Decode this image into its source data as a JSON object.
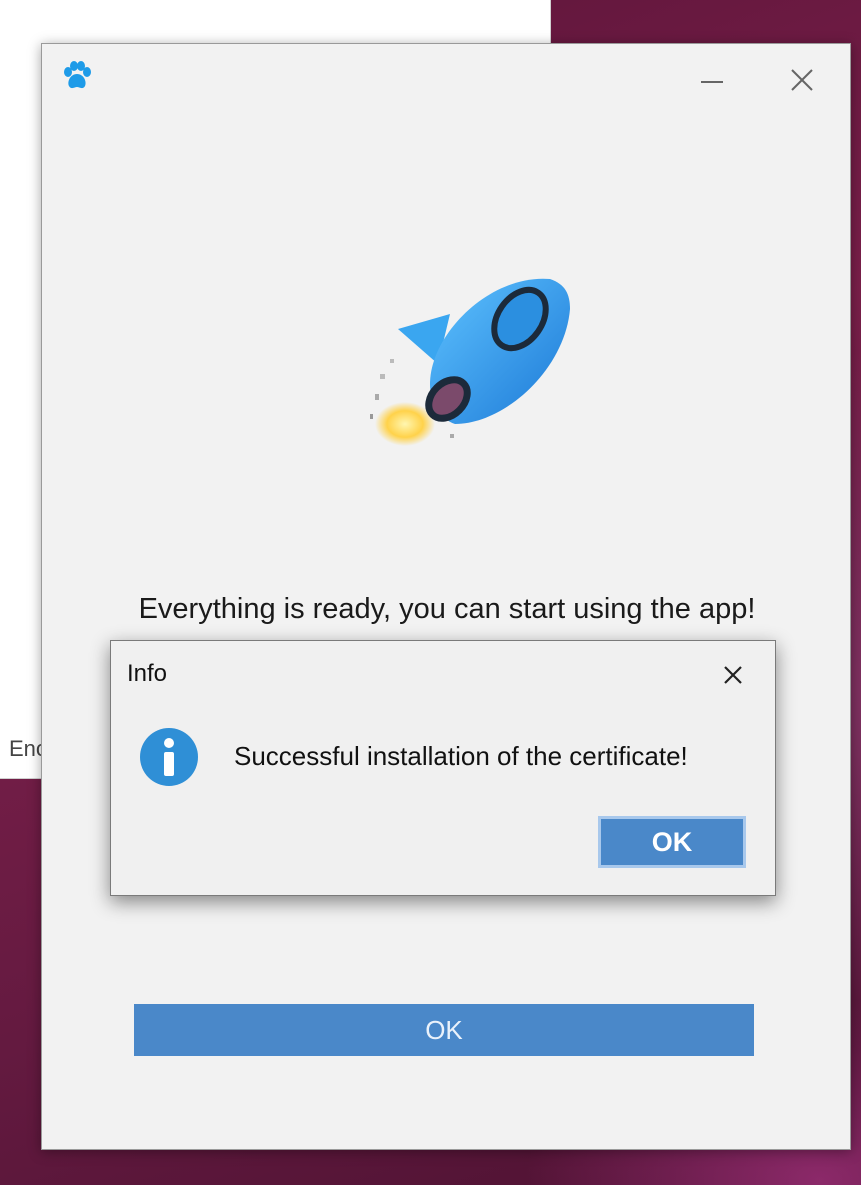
{
  "background_window": {
    "partial_text": "Enc"
  },
  "main_window": {
    "icon": "paw-icon",
    "controls": {
      "minimize_icon": "minimize-icon",
      "close_icon": "close-icon"
    },
    "illustration": "rocket-icon",
    "message": "Everything is ready, you can start using the app!",
    "ok_button_label": "OK"
  },
  "dialog": {
    "title": "Info",
    "close_icon": "close-icon",
    "icon": "info-icon",
    "message": "Successful installation of the certificate!",
    "ok_button_label": "OK"
  },
  "colors": {
    "accent_blue": "#4a88c9",
    "paw_blue": "#1e9be8",
    "info_blue": "#2f8fd6"
  }
}
